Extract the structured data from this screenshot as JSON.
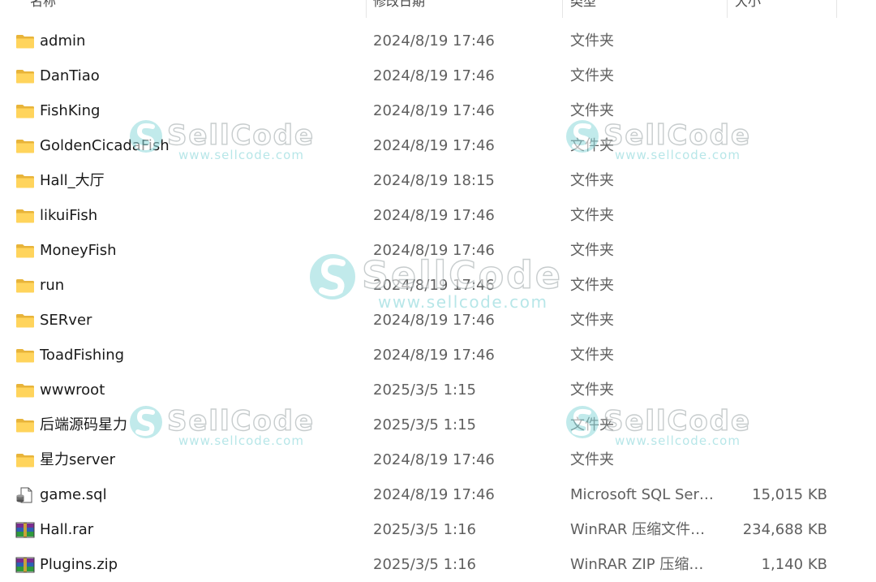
{
  "columns": {
    "name": "名称",
    "date": "修改日期",
    "type": "类型",
    "size": "大小"
  },
  "files": [
    {
      "name": "admin",
      "date": "2024/8/19 17:46",
      "type": "文件夹",
      "size": "",
      "icon": "folder-icon"
    },
    {
      "name": "DanTiao",
      "date": "2024/8/19 17:46",
      "type": "文件夹",
      "size": "",
      "icon": "folder-icon"
    },
    {
      "name": "FishKing",
      "date": "2024/8/19 17:46",
      "type": "文件夹",
      "size": "",
      "icon": "folder-icon"
    },
    {
      "name": "GoldenCicadaFish",
      "date": "2024/8/19 17:46",
      "type": "文件夹",
      "size": "",
      "icon": "folder-icon"
    },
    {
      "name": "Hall_大厅",
      "date": "2024/8/19 18:15",
      "type": "文件夹",
      "size": "",
      "icon": "folder-icon"
    },
    {
      "name": "likuiFish",
      "date": "2024/8/19 17:46",
      "type": "文件夹",
      "size": "",
      "icon": "folder-icon"
    },
    {
      "name": "MoneyFish",
      "date": "2024/8/19 17:46",
      "type": "文件夹",
      "size": "",
      "icon": "folder-icon"
    },
    {
      "name": "run",
      "date": "2024/8/19 17:46",
      "type": "文件夹",
      "size": "",
      "icon": "folder-icon"
    },
    {
      "name": "SERver",
      "date": "2024/8/19 17:46",
      "type": "文件夹",
      "size": "",
      "icon": "folder-icon"
    },
    {
      "name": "ToadFishing",
      "date": "2024/8/19 17:46",
      "type": "文件夹",
      "size": "",
      "icon": "folder-icon"
    },
    {
      "name": "wwwroot",
      "date": "2025/3/5 1:15",
      "type": "文件夹",
      "size": "",
      "icon": "folder-icon"
    },
    {
      "name": "后端源码星力",
      "date": "2025/3/5 1:15",
      "type": "文件夹",
      "size": "",
      "icon": "folder-icon"
    },
    {
      "name": "星力server",
      "date": "2024/8/19 17:46",
      "type": "文件夹",
      "size": "",
      "icon": "folder-icon"
    },
    {
      "name": "game.sql",
      "date": "2024/8/19 17:46",
      "type": "Microsoft SQL Serv...",
      "size": "15,015 KB",
      "icon": "sql-file-icon"
    },
    {
      "name": "Hall.rar",
      "date": "2025/3/5 1:16",
      "type": "WinRAR 压缩文件管...",
      "size": "234,688 KB",
      "icon": "winrar-archive-icon"
    },
    {
      "name": "Plugins.zip",
      "date": "2025/3/5 1:16",
      "type": "WinRAR ZIP 压缩文件",
      "size": "1,140 KB",
      "icon": "winrar-archive-icon"
    }
  ],
  "watermark": {
    "brand": "SellCode",
    "url": "www.sellcode.com"
  }
}
